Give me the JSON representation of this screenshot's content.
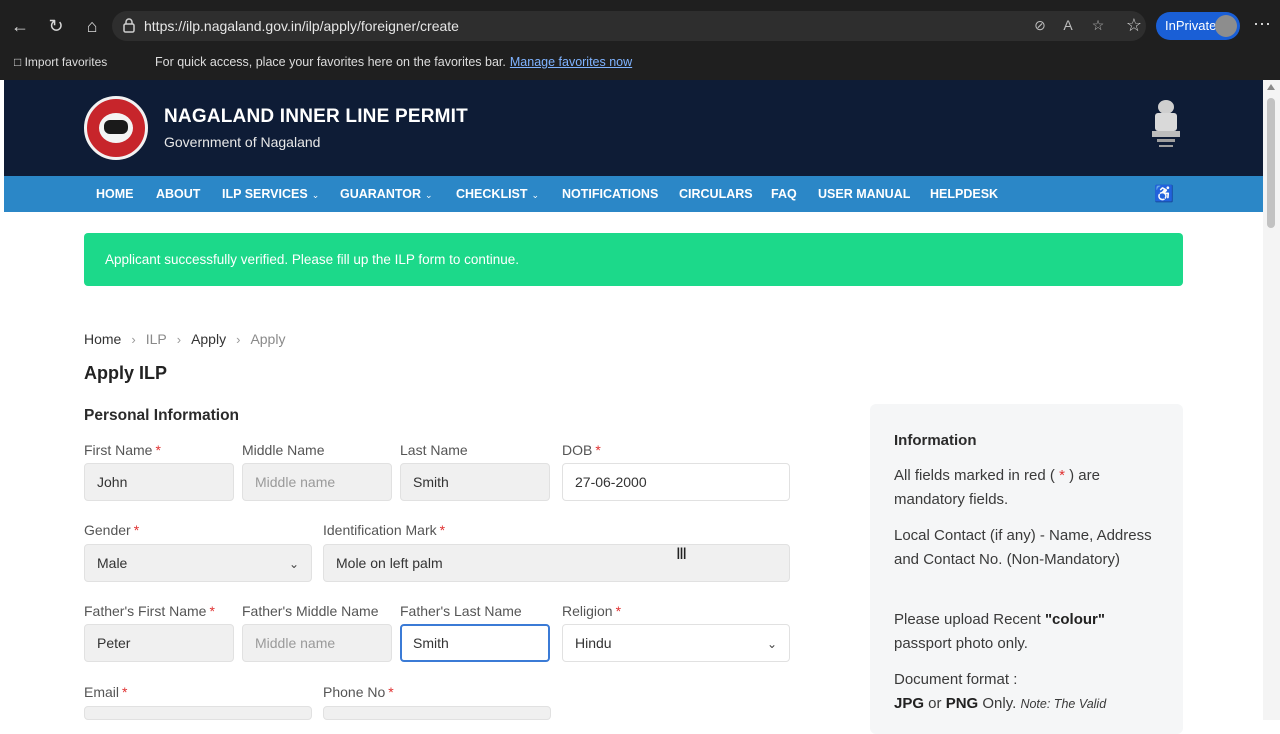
{
  "browser": {
    "url": "https://ilp.nagaland.gov.in/ilp/apply/foreigner/create",
    "profile_label": "InPrivate",
    "import_favorites": "Import favorites",
    "favorites_message": "For quick access, place your favorites here on the favorites bar.",
    "manage_favorites": "Manage favorites now"
  },
  "header": {
    "title": "NAGALAND INNER LINE PERMIT",
    "subtitle": "Government of Nagaland"
  },
  "nav": {
    "items": [
      {
        "label": "HOME"
      },
      {
        "label": "ABOUT"
      },
      {
        "label": "ILP SERVICES"
      },
      {
        "label": "GUARANTOR"
      },
      {
        "label": "CHECKLIST"
      },
      {
        "label": "NOTIFICATIONS"
      },
      {
        "label": "CIRCULARS"
      },
      {
        "label": "FAQ"
      },
      {
        "label": "USER MANUAL"
      },
      {
        "label": "HELPDESK"
      }
    ]
  },
  "alert": {
    "message": "Applicant successfully verified. Please fill up the ILP form to continue."
  },
  "breadcrumb": [
    "Home",
    "ILP",
    "Apply",
    "Apply"
  ],
  "page_title": "Apply ILP",
  "section_title": "Personal Information",
  "required_mark": "*",
  "form": {
    "first_name": {
      "label": "First Name",
      "value": "John"
    },
    "middle_name": {
      "label": "Middle Name",
      "placeholder": "Middle name"
    },
    "last_name": {
      "label": "Last Name",
      "value": "Smith"
    },
    "dob": {
      "label": "DOB",
      "value": "27-06-2000"
    },
    "gender": {
      "label": "Gender",
      "value": "Male"
    },
    "identification_mark": {
      "label": "Identification Mark",
      "value": "Mole on left palm"
    },
    "father_first_name": {
      "label": "Father's First Name",
      "value": "Peter"
    },
    "father_middle_name": {
      "label": "Father's Middle Name",
      "placeholder": "Middle name"
    },
    "father_last_name": {
      "label": "Father's Last Name",
      "value": "Smith"
    },
    "religion": {
      "label": "Religion",
      "value": "Hindu"
    },
    "email": {
      "label": "Email"
    },
    "phone": {
      "label": "Phone No"
    }
  },
  "info": {
    "title": "Information",
    "p1_a": "All fields marked in red (",
    "p1_star": " * ",
    "p1_b": ") are mandatory fields.",
    "p2": "Local Contact (if any) - Name, Address and Contact No. (Non-Mandatory)",
    "p3_a": "Please upload Recent ",
    "p3_bold": "\"colour\"",
    "p3_b": " passport photo only.",
    "p4_a": "Document format :",
    "p4_jpg": "JPG",
    "p4_or": " or ",
    "p4_png": "PNG",
    "p4_only": " Only. ",
    "p4_note": "Note: The Valid"
  },
  "colors": {
    "header_bg": "#0e1c36",
    "nav_bg": "#2b87c7",
    "alert_bg": "#1cd98a",
    "required": "#e03131",
    "focus_border": "#3b7bd6"
  }
}
